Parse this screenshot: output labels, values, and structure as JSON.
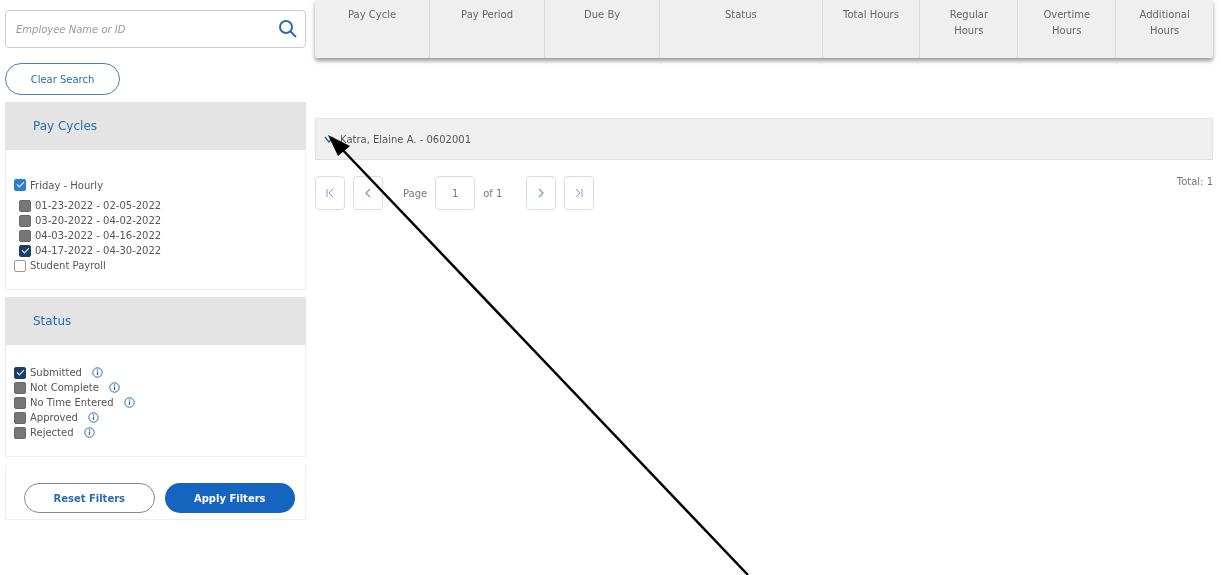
{
  "search": {
    "placeholder": "Employee Name or ID"
  },
  "clear_button": "Clear Search",
  "pay_cycles": {
    "title": "Pay Cycles",
    "items": [
      {
        "label": "Friday - Hourly",
        "checked": true,
        "children": [
          {
            "label": "01-23-2022 - 02-05-2022",
            "checked": false
          },
          {
            "label": "03-20-2022 - 04-02-2022",
            "checked": false
          },
          {
            "label": "04-03-2022 - 04-16-2022",
            "checked": false
          },
          {
            "label": "04-17-2022 - 04-30-2022",
            "checked": true
          }
        ]
      },
      {
        "label": "Student Payroll",
        "checked": false
      }
    ]
  },
  "status": {
    "title": "Status",
    "items": [
      {
        "label": "Submitted",
        "checked": true
      },
      {
        "label": "Not Complete",
        "checked": false
      },
      {
        "label": "No Time Entered",
        "checked": false
      },
      {
        "label": "Approved",
        "checked": false
      },
      {
        "label": "Rejected",
        "checked": false
      }
    ]
  },
  "filter_buttons": [
    {
      "label": "Reset Filters",
      "kind": "outline"
    },
    {
      "label": "Apply Filters",
      "kind": "primary"
    }
  ],
  "table": {
    "columns": [
      "Pay Cycle",
      "Pay Period",
      "Due By",
      "Status",
      "Total Hours",
      "Regular Hours",
      "Overtime Hours",
      "Additional Hours"
    ]
  },
  "employees": [
    {
      "name": "Katra, Elaine A. - 0602001",
      "expanded": false
    }
  ],
  "pagination": {
    "page_label": "Page",
    "page": "1",
    "of": "of 1",
    "total": "Total: 1"
  }
}
